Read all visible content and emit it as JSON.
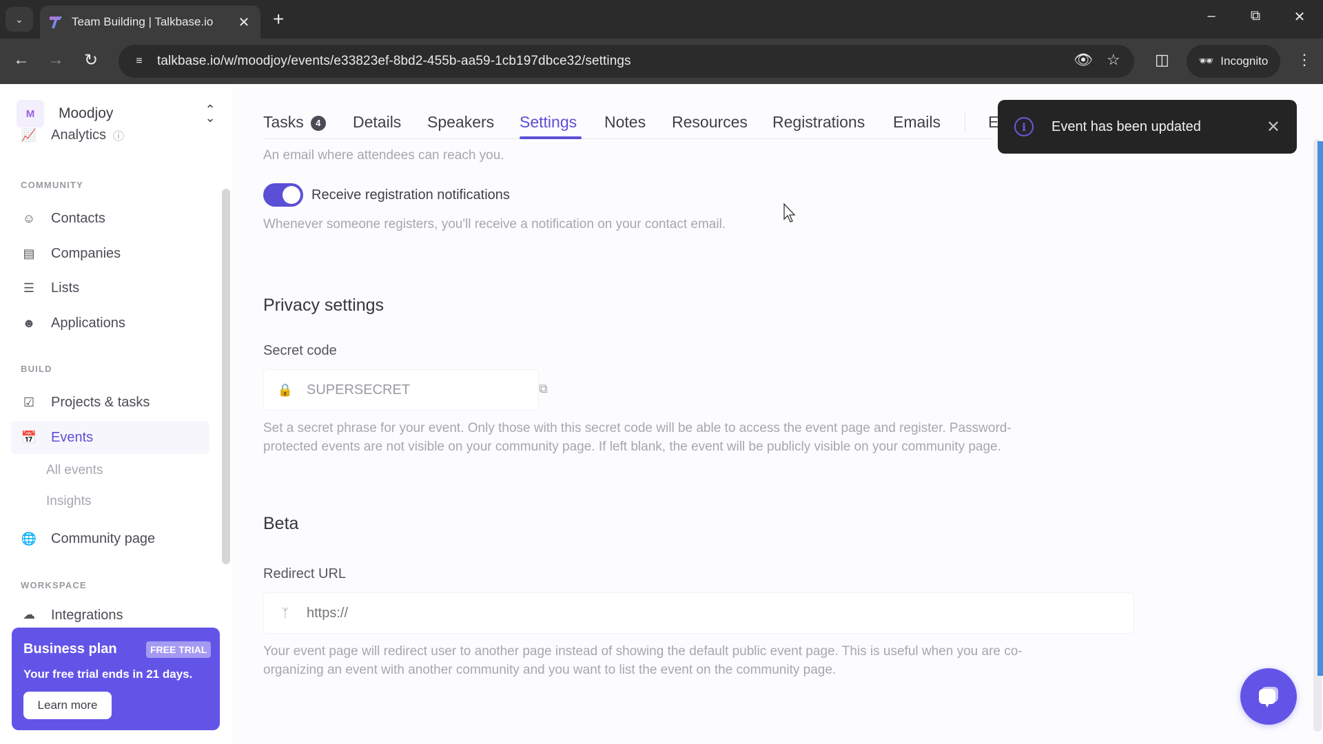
{
  "browser": {
    "tab_title": "Team Building | Talkbase.io",
    "new_tab_glyph": "+",
    "url": "talkbase.io/w/moodjoy/events/e33823ef-8bd2-455b-aa59-1cb197dbce32/settings",
    "incognito_label": "Incognito"
  },
  "sidebar": {
    "workspace": {
      "initial": "M",
      "name": "Moodjoy"
    },
    "top_items": [
      {
        "label": "Analytics",
        "icon": "chart-icon"
      }
    ],
    "sections": [
      {
        "label": "COMMUNITY",
        "items": [
          {
            "label": "Contacts",
            "icon": "users-icon"
          },
          {
            "label": "Companies",
            "icon": "building-icon"
          },
          {
            "label": "Lists",
            "icon": "list-icon"
          },
          {
            "label": "Applications",
            "icon": "user-plus-icon"
          }
        ]
      },
      {
        "label": "BUILD",
        "items": [
          {
            "label": "Projects & tasks",
            "icon": "task-check-icon"
          },
          {
            "label": "Events",
            "icon": "calendar-icon",
            "active": true,
            "children": [
              "All events",
              "Insights"
            ]
          },
          {
            "label": "Community page",
            "icon": "globe-icon"
          }
        ]
      },
      {
        "label": "WORKSPACE",
        "items": [
          {
            "label": "Integrations",
            "icon": "integrations-icon"
          }
        ]
      }
    ],
    "promo": {
      "title": "Business plan",
      "badge": "FREE TRIAL",
      "text": "Your free trial ends in 21 days.",
      "button": "Learn more"
    }
  },
  "tabs": [
    {
      "label": "Tasks",
      "badge": "4"
    },
    {
      "label": "Details"
    },
    {
      "label": "Speakers"
    },
    {
      "label": "Settings",
      "active": true
    },
    {
      "label": "Notes"
    },
    {
      "label": "Resources"
    },
    {
      "label": "Registrations"
    },
    {
      "label": "Emails"
    },
    {
      "label": "E"
    }
  ],
  "content": {
    "contact_email_help": "An email where attendees can reach you.",
    "registration_toggle": {
      "label": "Receive registration notifications",
      "enabled": true,
      "help": "Whenever someone registers, you'll receive a notification on your contact email."
    },
    "privacy": {
      "title": "Privacy settings",
      "secret_code_label": "Secret code",
      "secret_code_value": "SUPERSECRET",
      "help_line1": "Set a secret phrase for your event. Only those with this secret code will be able to access the event page and register. Password-",
      "help_line2": "protected events are not visible on your community page. If left blank, the event will be publicly visible on your community page."
    },
    "beta": {
      "title": "Beta",
      "redirect_label": "Redirect URL",
      "redirect_placeholder": "https://",
      "help_line1": "Your event page will redirect user to another page instead of showing the default public event page. This is useful when you are co-",
      "help_line2": "organizing an event with another community and you want to list the event on the community page."
    }
  },
  "toast": {
    "message": "Event has been updated"
  },
  "colors": {
    "accent": "#5b4fd6",
    "promo": "#6354e8",
    "toast_bg": "#242424"
  }
}
